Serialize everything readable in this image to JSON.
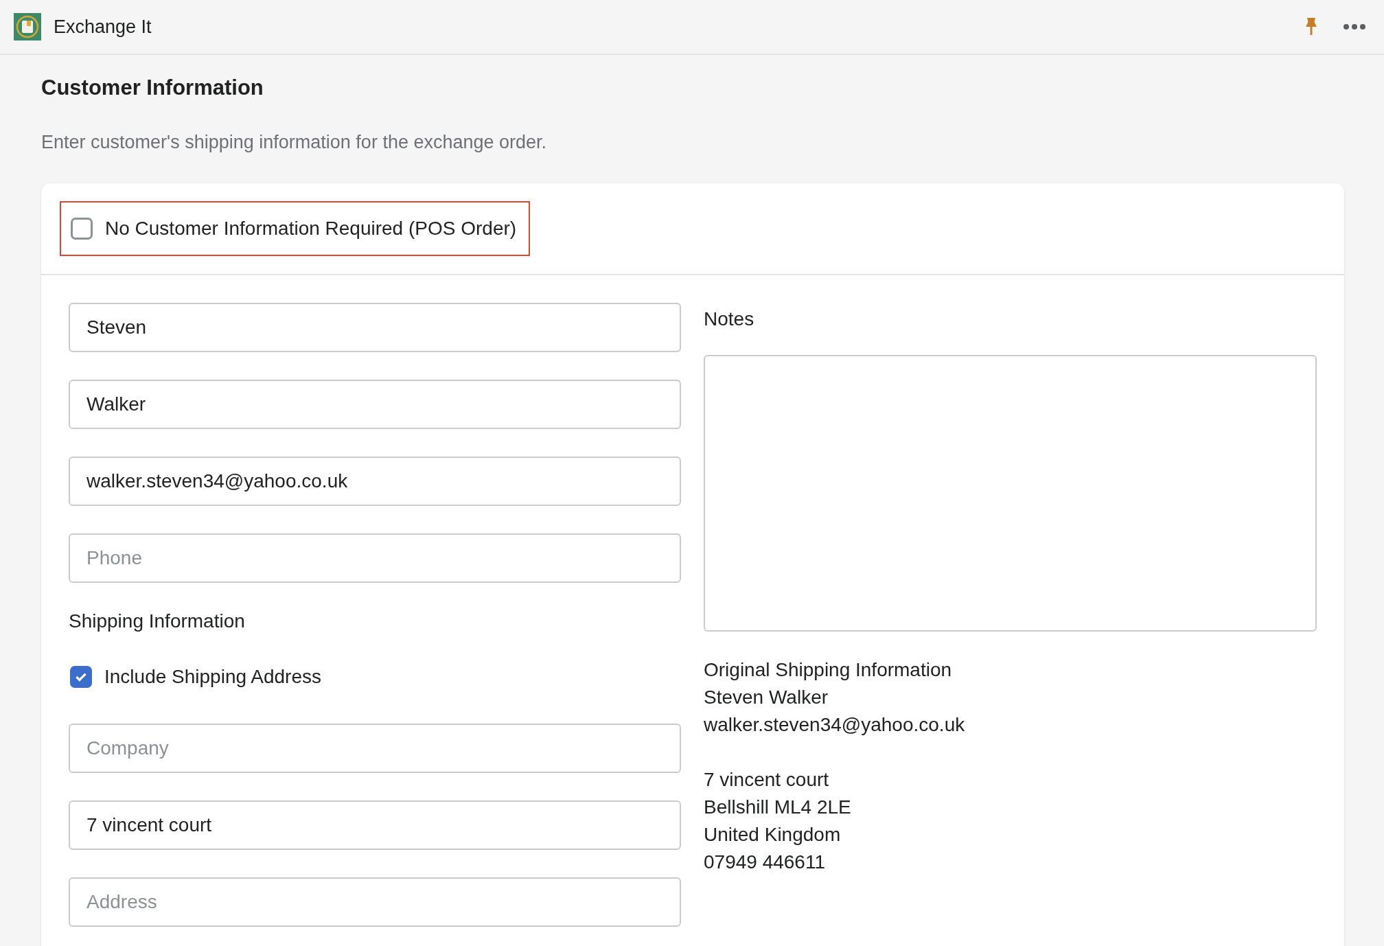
{
  "app": {
    "title": "Exchange It"
  },
  "page": {
    "title": "Customer Information",
    "description": "Enter customer's shipping information for the exchange order."
  },
  "no_customer_info": {
    "label": "No Customer Information Required (POS Order)",
    "checked": false,
    "highlighted": true
  },
  "contact_fields": [
    {
      "value": "Steven"
    },
    {
      "value": "Walker"
    },
    {
      "value": "walker.steven34@yahoo.co.uk"
    },
    {
      "placeholder": "Phone"
    }
  ],
  "shipping": {
    "title": "Shipping Information",
    "include_address": {
      "label": "Include Shipping Address",
      "checked": true
    },
    "fields": [
      {
        "placeholder": "Company"
      },
      {
        "value": "7 vincent court"
      },
      {
        "placeholder": "Address"
      }
    ]
  },
  "notes": {
    "label": "Notes"
  },
  "original_shipping": [
    [
      "Original Shipping Information",
      "Steven Walker",
      "walker.steven34@yahoo.co.uk"
    ],
    [
      "7 vincent court",
      "Bellshill ML4 2LE",
      "United Kingdom",
      "07949 446611"
    ]
  ]
}
